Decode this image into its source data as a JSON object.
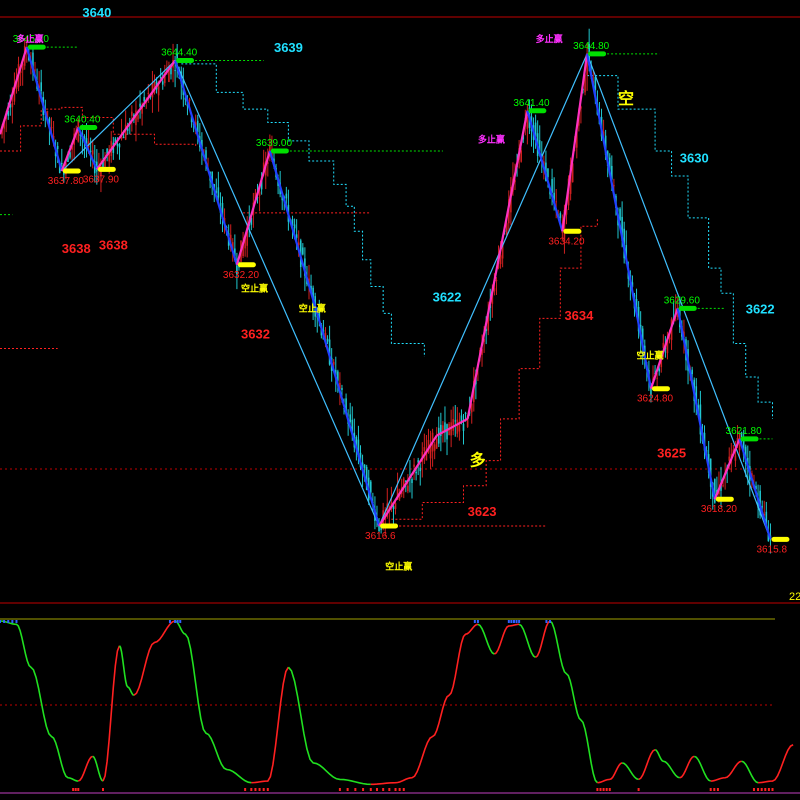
{
  "colors": {
    "background": "#000000",
    "frame_line": "#c00000",
    "up_candle": "#d02020",
    "down_candle": "#20c8d0",
    "zigzag_up": "#ff30c0",
    "zigzag_down": "#2040ff",
    "trend_line": "#40c0ff",
    "peak_marker": "#00e000",
    "trough_marker": "#ffff00",
    "high_label": "#00ff00",
    "low_label": "#ff2020",
    "level_red": "#ff2020",
    "level_cyan": "#20e0ff",
    "signal_magenta": "#ff30ff",
    "signal_yellow": "#ffff00",
    "osc_up": "#ff2020",
    "osc_down": "#20e020",
    "osc_top": "#a0a000"
  },
  "chart_data": {
    "type": "line",
    "title": "",
    "xlabel": "",
    "ylabel": "",
    "ylim": [
      3612,
      3647
    ],
    "axis_value": "22",
    "zigzag": [
      {
        "x": 0,
        "y": 3640.0
      },
      {
        "x": 13,
        "y": 3645.2,
        "label": "3645.20"
      },
      {
        "x": 30,
        "y": 3637.8,
        "label": "3637.80"
      },
      {
        "x": 38,
        "y": 3640.4,
        "label": "3640.40"
      },
      {
        "x": 47,
        "y": 3637.9,
        "label": "3637.90"
      },
      {
        "x": 85,
        "y": 3644.4,
        "label": "3644.40"
      },
      {
        "x": 115,
        "y": 3632.2,
        "label": "3632.20"
      },
      {
        "x": 131,
        "y": 3639.0,
        "label": "3639.00"
      },
      {
        "x": 184,
        "y": 3616.6,
        "label": "3616.6"
      },
      {
        "x": 212,
        "y": 3622.0
      },
      {
        "x": 227,
        "y": 3623.0
      },
      {
        "x": 256,
        "y": 3641.4,
        "label": "3641.40"
      },
      {
        "x": 273,
        "y": 3634.2,
        "label": "3634.20"
      },
      {
        "x": 285,
        "y": 3644.8,
        "label": "3644.80"
      },
      {
        "x": 316,
        "y": 3624.8,
        "label": "3624.80"
      },
      {
        "x": 329,
        "y": 3629.6,
        "label": "3629.60"
      },
      {
        "x": 347,
        "y": 3618.2,
        "label": "3618.20"
      },
      {
        "x": 359,
        "y": 3621.8,
        "label": "3621.80"
      },
      {
        "x": 374,
        "y": 3615.8,
        "label": "3615.8"
      }
    ],
    "trend_lines": [
      {
        "from": [
          30,
          3637.8
        ],
        "to": [
          85,
          3644.4
        ]
      },
      {
        "from": [
          85,
          3644.4
        ],
        "to": [
          184,
          3616.6
        ]
      },
      {
        "from": [
          184,
          3616.6
        ],
        "to": [
          285,
          3644.8
        ]
      },
      {
        "from": [
          285,
          3644.8
        ],
        "to": [
          374,
          3615.8
        ]
      }
    ],
    "level_labels": [
      {
        "text": "3640",
        "x": 40,
        "y": 3647.0,
        "color": "cyan"
      },
      {
        "text": "3639",
        "x": 133,
        "y": 3644.9,
        "color": "cyan"
      },
      {
        "text": "3638",
        "x": 30,
        "y": 3632.9,
        "color": "red"
      },
      {
        "text": "3638",
        "x": 48,
        "y": 3633.1,
        "color": "red"
      },
      {
        "text": "3632",
        "x": 117,
        "y": 3627.8,
        "color": "red"
      },
      {
        "text": "3622",
        "x": 210,
        "y": 3630.0,
        "color": "cyan"
      },
      {
        "text": "3634",
        "x": 274,
        "y": 3628.9,
        "color": "red"
      },
      {
        "text": "3630",
        "x": 330,
        "y": 3638.3,
        "color": "cyan"
      },
      {
        "text": "3622",
        "x": 362,
        "y": 3629.3,
        "color": "cyan"
      },
      {
        "text": "3623",
        "x": 227,
        "y": 3617.2,
        "color": "red"
      },
      {
        "text": "3625",
        "x": 319,
        "y": 3620.7,
        "color": "red"
      }
    ],
    "signals": [
      {
        "text": "多止赢",
        "x": 8,
        "y": 3645.5,
        "color": "magenta"
      },
      {
        "text": "多止赢",
        "x": 260,
        "y": 3645.5,
        "color": "magenta"
      },
      {
        "text": "多止赢",
        "x": 232,
        "y": 3639.5,
        "color": "magenta"
      },
      {
        "text": "空止赢",
        "x": 117,
        "y": 3630.6,
        "color": "yellow"
      },
      {
        "text": "空止赢",
        "x": 145,
        "y": 3629.4,
        "color": "yellow"
      },
      {
        "text": "空止赢",
        "x": 187,
        "y": 3614.0,
        "color": "yellow"
      },
      {
        "text": "空止赢",
        "x": 309,
        "y": 3626.6,
        "color": "yellow"
      },
      {
        "text": "多",
        "x": 228,
        "y": 3620.2,
        "color": "yellow",
        "big": true
      },
      {
        "text": "空",
        "x": 300,
        "y": 3641.8,
        "color": "yellow",
        "big": true
      }
    ],
    "oscillator": {
      "ylim": [
        0,
        100
      ],
      "x": [
        0,
        8,
        15,
        25,
        33,
        38,
        45,
        50,
        58,
        62,
        65,
        75,
        85,
        90,
        100,
        110,
        122,
        130,
        140,
        152,
        165,
        180,
        192,
        200,
        210,
        218,
        226,
        232,
        240,
        247,
        252,
        260,
        267,
        275,
        282,
        290,
        296,
        302,
        310,
        318,
        322,
        330,
        337,
        345,
        352,
        360,
        368,
        375,
        385
      ],
      "values": [
        100,
        98,
        72,
        30,
        5,
        3,
        18,
        3,
        85,
        60,
        55,
        87,
        100,
        92,
        32,
        10,
        2,
        3,
        72,
        14,
        4,
        1,
        2,
        5,
        30,
        55,
        92,
        98,
        80,
        97,
        98,
        78,
        100,
        68,
        40,
        2,
        4,
        14,
        4,
        22,
        15,
        5,
        18,
        3,
        5,
        15,
        2,
        3,
        25
      ]
    }
  }
}
